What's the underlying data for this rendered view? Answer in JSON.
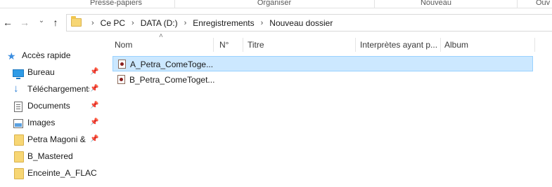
{
  "ribbon": {
    "groups": [
      "Presse-papiers",
      "Organiser",
      "Nouveau",
      "Ouv"
    ]
  },
  "nav": {
    "back_glyph": "←",
    "forward_glyph": "→",
    "recent_glyph": "⌄",
    "up_glyph": "↑",
    "breadcrumbs": [
      "Ce PC",
      "DATA (D:)",
      "Enregistrements",
      "Nouveau dossier"
    ],
    "separator": "›"
  },
  "sidebar": {
    "quick_access": "Accès rapide",
    "items": [
      {
        "label": "Bureau",
        "icon": "desktop-icon",
        "pinned": true
      },
      {
        "label": "Téléchargements",
        "icon": "download-icon",
        "pinned": true
      },
      {
        "label": "Documents",
        "icon": "documents-icon",
        "pinned": true
      },
      {
        "label": "Images",
        "icon": "pictures-icon",
        "pinned": true
      },
      {
        "label": "Petra Magoni &",
        "icon": "folder-icon",
        "pinned": true
      },
      {
        "label": "B_Mastered",
        "icon": "folder-icon",
        "pinned": false
      },
      {
        "label": "Enceinte_A_FLAC",
        "icon": "folder-icon",
        "pinned": false
      }
    ],
    "pin_glyph": "📌"
  },
  "columns": {
    "sort_glyph": "˄",
    "headers": [
      "Nom",
      "N°",
      "Titre",
      "Interprètes ayant p...",
      "Album"
    ]
  },
  "files": [
    {
      "name": "A_Petra_ComeToge...",
      "selected": true
    },
    {
      "name": "B_Petra_ComeToget...",
      "selected": false
    }
  ],
  "colors": {
    "selection_bg": "#cce8ff",
    "selection_border": "#99d1ff",
    "folder": "#f7d674",
    "accent": "#3b8de0"
  }
}
